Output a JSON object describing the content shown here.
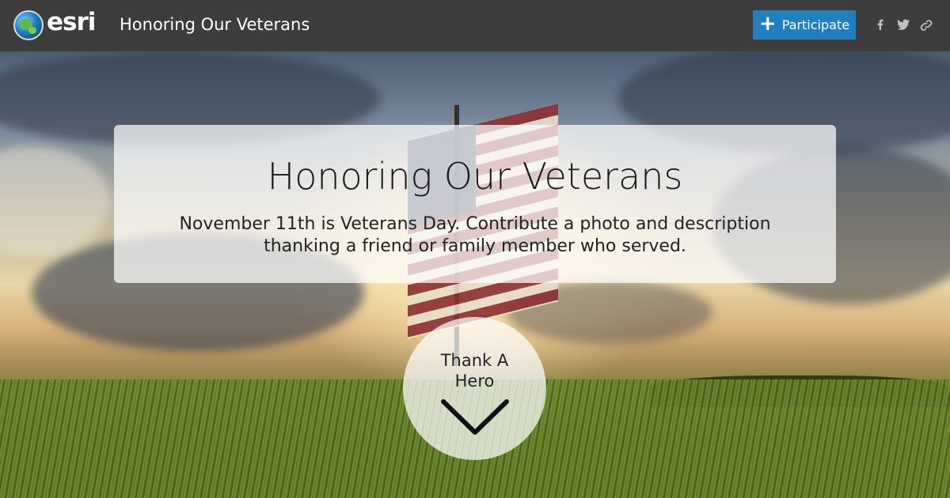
{
  "header": {
    "logo_text": "esri",
    "title": "Honoring Our Veterans",
    "participate_label": "Participate",
    "social_icons": [
      "facebook-icon",
      "twitter-icon",
      "link-icon"
    ]
  },
  "hero": {
    "title": "Honoring Our Veterans",
    "description": "November 11th is Veterans Day. Contribute a photo and description thanking a friend or family member who served.",
    "cta_label": "Thank A Hero"
  },
  "colors": {
    "header_bg": "#3d3d3d",
    "accent": "#1f7fc0",
    "card_bg": "rgba(255,255,255,0.72)"
  }
}
